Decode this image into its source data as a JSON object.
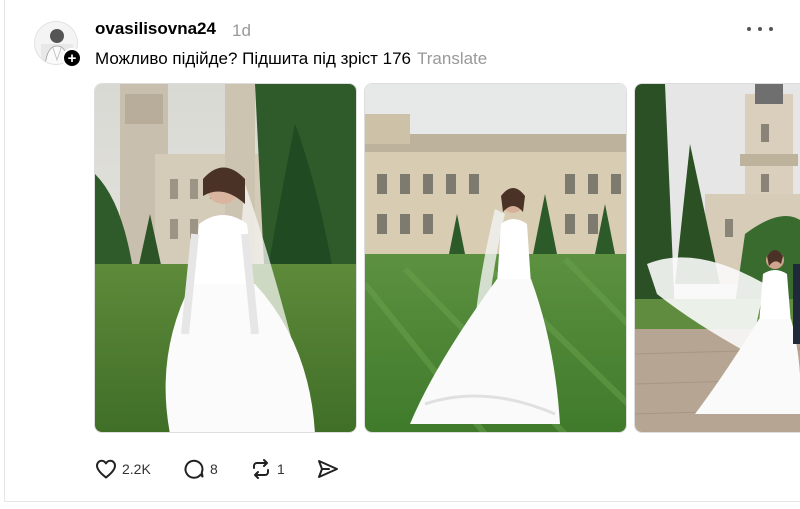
{
  "post": {
    "username": "ovasilisovna24",
    "time": "1d",
    "caption": "Можливо підійде? Підшита під зріст 176",
    "translate": "Translate",
    "follow_symbol": "+"
  },
  "photos": [
    {
      "name": "bride-castle-garden"
    },
    {
      "name": "bride-lawn-palace"
    },
    {
      "name": "bride-veil-tower"
    }
  ],
  "actions": {
    "likes": "2.2K",
    "replies": "8",
    "reposts": "1"
  },
  "icons": {
    "like": "heart-icon",
    "reply": "comment-icon",
    "repost": "repost-icon",
    "share": "send-icon",
    "more": "more-dots-icon"
  }
}
